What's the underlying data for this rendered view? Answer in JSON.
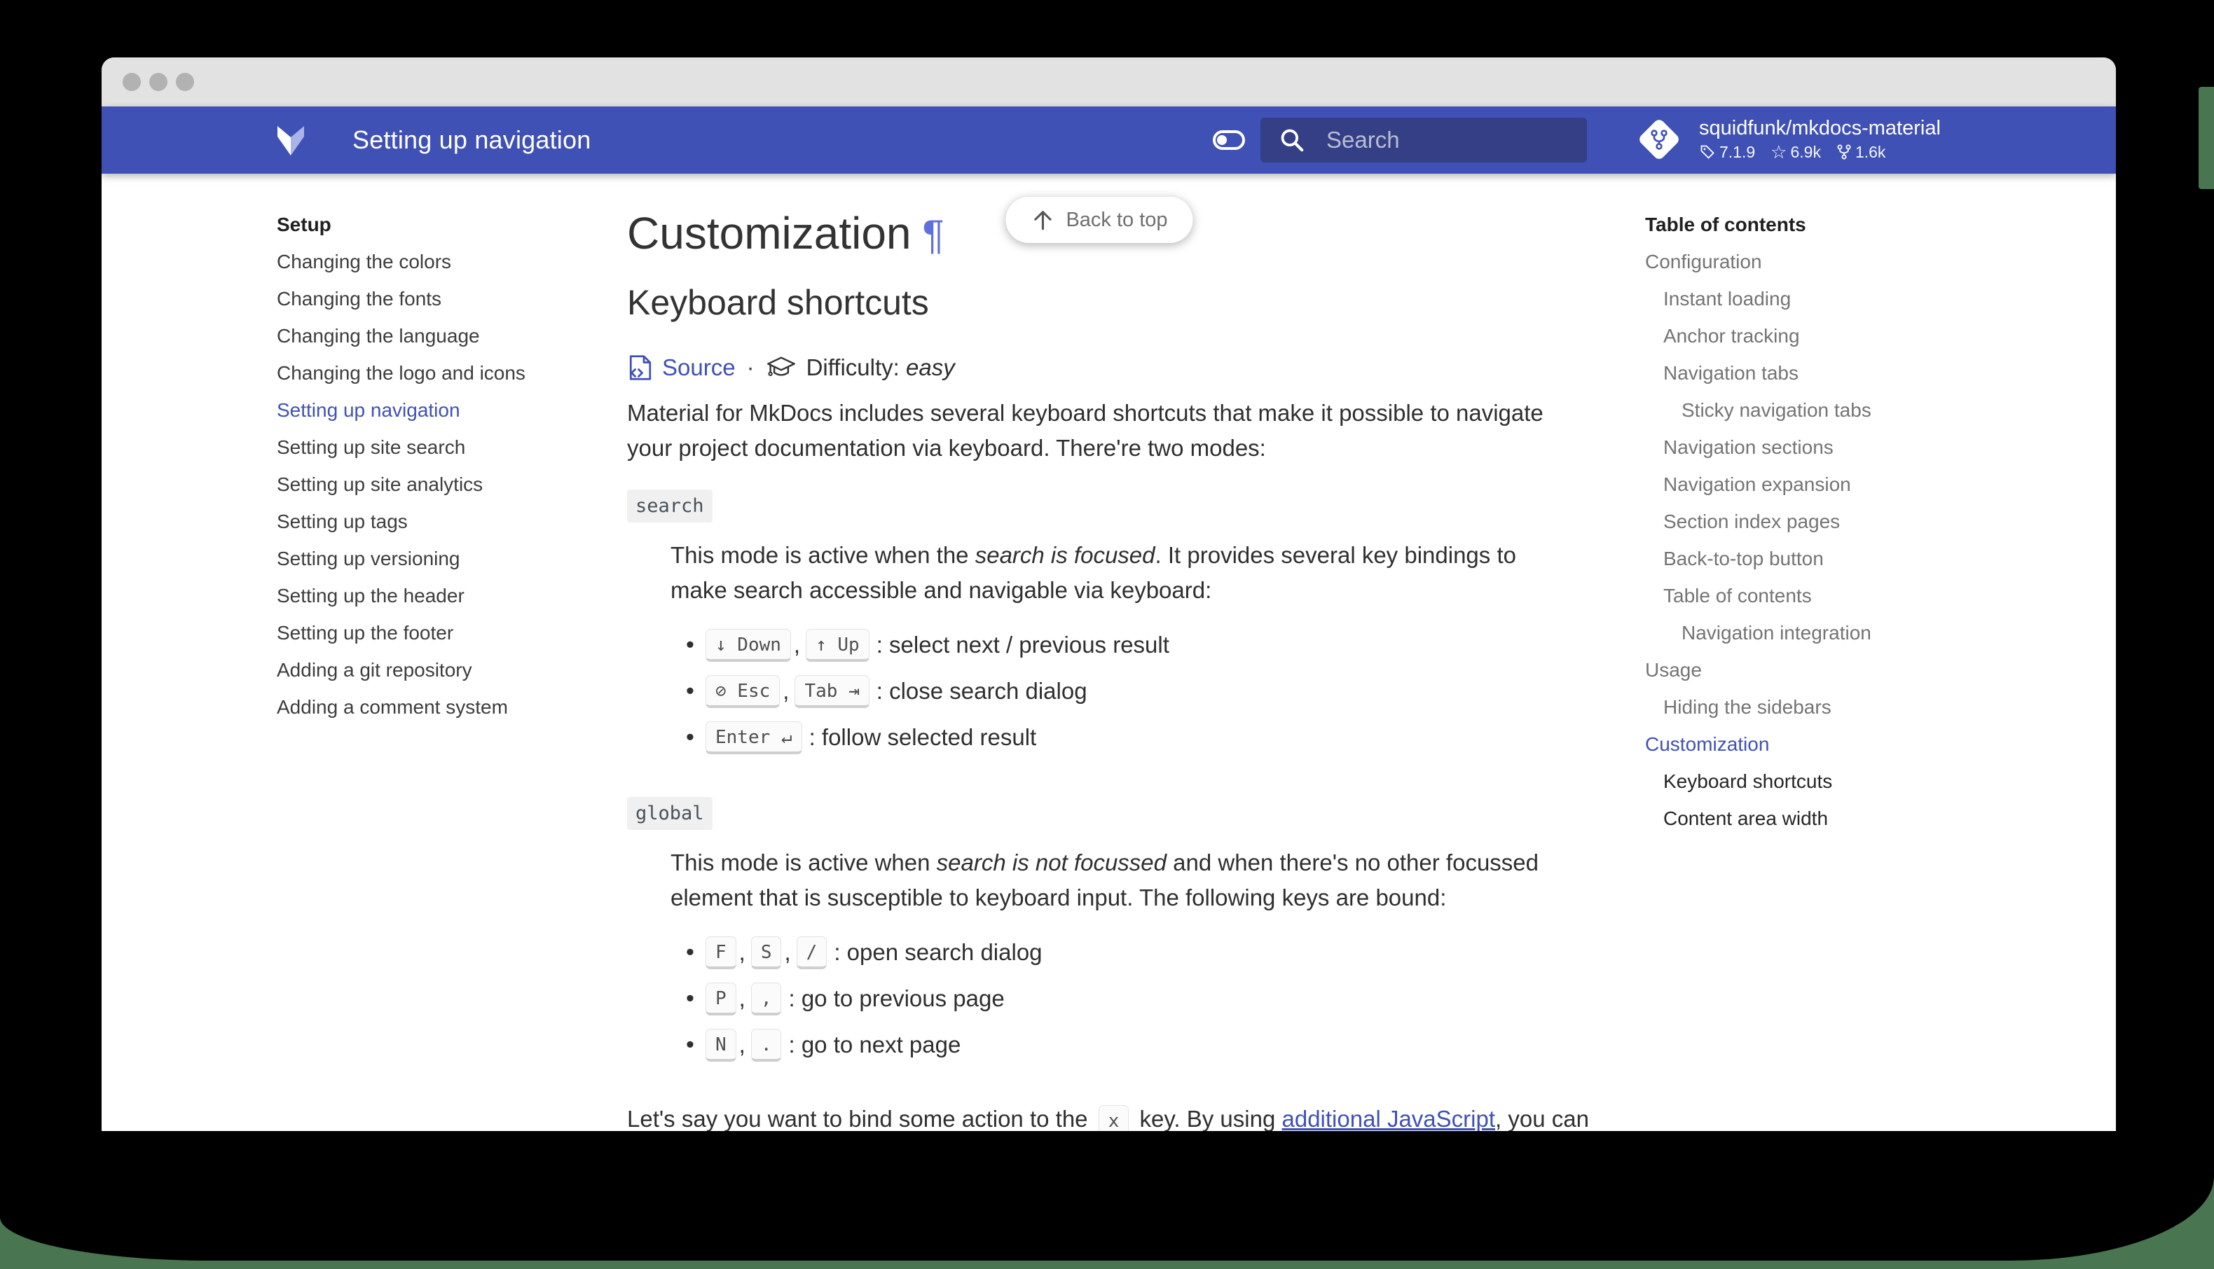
{
  "colors": {
    "header_blue": "#4051b5",
    "search_bg": "#343f85",
    "accent_link": "#4051b5",
    "wallpaper_green": "#4a7551",
    "titlebar_gray": "#e2e2e2"
  },
  "header": {
    "title": "Setting up navigation",
    "search_placeholder": "Search",
    "repo": {
      "name": "squidfunk/mkdocs-material",
      "version": "7.1.9",
      "stars": "6.9k",
      "forks": "1.6k"
    }
  },
  "sidebar": {
    "section_label": "Setup",
    "items": [
      {
        "label": "Changing the colors",
        "active": false
      },
      {
        "label": "Changing the fonts",
        "active": false
      },
      {
        "label": "Changing the language",
        "active": false
      },
      {
        "label": "Changing the logo and icons",
        "active": false
      },
      {
        "label": "Setting up navigation",
        "active": true
      },
      {
        "label": "Setting up site search",
        "active": false
      },
      {
        "label": "Setting up site analytics",
        "active": false
      },
      {
        "label": "Setting up tags",
        "active": false
      },
      {
        "label": "Setting up versioning",
        "active": false
      },
      {
        "label": "Setting up the header",
        "active": false
      },
      {
        "label": "Setting up the footer",
        "active": false
      },
      {
        "label": "Adding a git repository",
        "active": false
      },
      {
        "label": "Adding a comment system",
        "active": false
      }
    ]
  },
  "toc": {
    "title": "Table of contents",
    "items": [
      {
        "label": "Configuration",
        "level": 1,
        "state": "default"
      },
      {
        "label": "Instant loading",
        "level": 2,
        "state": "default"
      },
      {
        "label": "Anchor tracking",
        "level": 2,
        "state": "default"
      },
      {
        "label": "Navigation tabs",
        "level": 2,
        "state": "default"
      },
      {
        "label": "Sticky navigation tabs",
        "level": 3,
        "state": "default"
      },
      {
        "label": "Navigation sections",
        "level": 2,
        "state": "default"
      },
      {
        "label": "Navigation expansion",
        "level": 2,
        "state": "default"
      },
      {
        "label": "Section index pages",
        "level": 2,
        "state": "default"
      },
      {
        "label": "Back-to-top button",
        "level": 2,
        "state": "default"
      },
      {
        "label": "Table of contents",
        "level": 2,
        "state": "default"
      },
      {
        "label": "Navigation integration",
        "level": 3,
        "state": "default"
      },
      {
        "label": "Usage",
        "level": 1,
        "state": "default"
      },
      {
        "label": "Hiding the sidebars",
        "level": 2,
        "state": "default"
      },
      {
        "label": "Customization",
        "level": 1,
        "state": "active"
      },
      {
        "label": "Keyboard shortcuts",
        "level": 2,
        "state": "current"
      },
      {
        "label": "Content area width",
        "level": 2,
        "state": "current"
      }
    ]
  },
  "content": {
    "h1": "Customization",
    "pilcrow": "¶",
    "back_to_top": "Back to top",
    "h2": "Keyboard shortcuts",
    "meta": {
      "source_label": "Source",
      "separator": "·",
      "difficulty_label": "Difficulty:",
      "difficulty_value": "easy"
    },
    "intro": [
      {
        "t": "text",
        "v": "Material for MkDocs includes several keyboard shortcuts that make it possible to navigate your project documentation via keyboard. There're two modes:"
      }
    ],
    "modes": [
      {
        "chip": "search",
        "desc": [
          {
            "t": "text",
            "v": "This mode is active when the "
          },
          {
            "t": "em",
            "v": "search is focused"
          },
          {
            "t": "text",
            "v": ". It provides several key bindings to make search accessible and navigable via keyboard:"
          }
        ],
        "bindings": [
          {
            "keys": [
              "↓ Down",
              "↑ Up"
            ],
            "desc": ": select next / previous result"
          },
          {
            "keys": [
              "⊘ Esc",
              "Tab ⇥"
            ],
            "desc": ": close search dialog"
          },
          {
            "keys": [
              "Enter ↵"
            ],
            "desc": ": follow selected result"
          }
        ]
      },
      {
        "chip": "global",
        "desc": [
          {
            "t": "text",
            "v": "This mode is active when "
          },
          {
            "t": "em",
            "v": "search is not focussed"
          },
          {
            "t": "text",
            "v": " and when there's no other focussed element that is susceptible to keyboard input. The following keys are bound:"
          }
        ],
        "bindings": [
          {
            "keys": [
              "F",
              "S",
              "/"
            ],
            "desc": ": open search dialog"
          },
          {
            "keys": [
              "P",
              ","
            ],
            "desc": ": go to previous page"
          },
          {
            "keys": [
              "N",
              "."
            ],
            "desc": ": go to next page"
          }
        ]
      }
    ],
    "outro": [
      {
        "t": "text",
        "v": "Let's say you want to bind some action to the "
      },
      {
        "t": "kbd",
        "v": "x"
      },
      {
        "t": "text",
        "v": " key. By using "
      },
      {
        "t": "link",
        "v": "additional JavaScript"
      },
      {
        "t": "text",
        "v": ", you can"
      }
    ]
  }
}
